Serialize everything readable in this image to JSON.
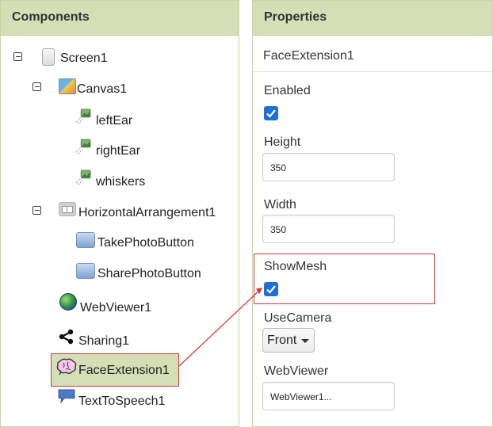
{
  "components": {
    "header": "Components",
    "tree": [
      {
        "label": "Screen1",
        "icon": "screen-icon"
      },
      {
        "label": "Canvas1",
        "icon": "canvas-icon"
      },
      {
        "label": "leftEar",
        "icon": "image-sprite-icon"
      },
      {
        "label": "rightEar",
        "icon": "image-sprite-icon"
      },
      {
        "label": "whiskers",
        "icon": "image-sprite-icon"
      },
      {
        "label": "HorizontalArrangement1",
        "icon": "horizontal-arrangement-icon"
      },
      {
        "label": "TakePhotoButton",
        "icon": "button-icon"
      },
      {
        "label": "SharePhotoButton",
        "icon": "button-icon"
      },
      {
        "label": "WebViewer1",
        "icon": "globe-icon"
      },
      {
        "label": "Sharing1",
        "icon": "share-icon"
      },
      {
        "label": "FaceExtension1",
        "icon": "brain-icon",
        "selected": true
      },
      {
        "label": "TextToSpeech1",
        "icon": "speech-bubble-icon"
      }
    ]
  },
  "properties": {
    "header": "Properties",
    "component_name": "FaceExtension1",
    "enabled": {
      "label": "Enabled",
      "checked": true
    },
    "height": {
      "label": "Height",
      "value": "350"
    },
    "width": {
      "label": "Width",
      "value": "350"
    },
    "show_mesh": {
      "label": "ShowMesh",
      "checked": true
    },
    "use_camera": {
      "label": "UseCamera",
      "value": "Front"
    },
    "web_viewer": {
      "label": "WebViewer",
      "value": "WebViewer1..."
    }
  },
  "colors": {
    "header_bg": "#d4dfb6",
    "selected_bg": "#d4dfb6",
    "callout_red": "#d43b3b",
    "checkbox_blue": "#1f6fd6"
  }
}
